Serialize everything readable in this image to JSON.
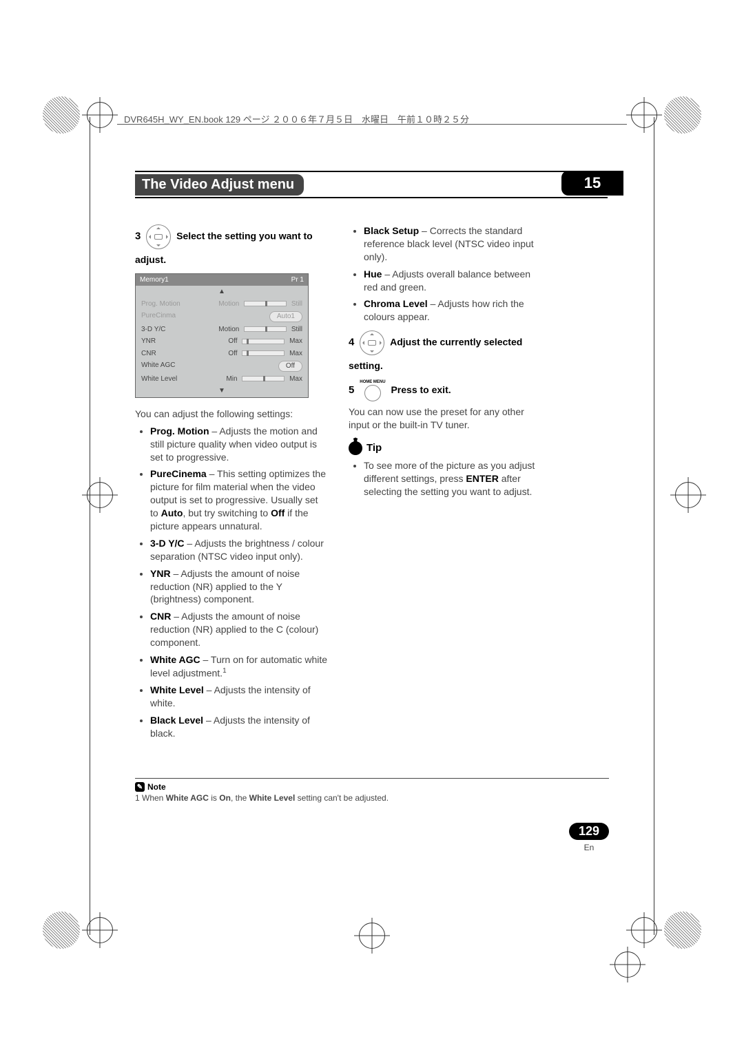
{
  "header_line": "DVR645H_WY_EN.book 129 ページ ２００６年７月５日　水曜日　午前１０時２５分",
  "title": "The Video Adjust menu",
  "chapter": "15",
  "step3": {
    "num": "3",
    "text_a": "Select the setting you want to",
    "text_b": "adjust."
  },
  "intro": "You can adjust the following settings:",
  "bullets_left": [
    {
      "term": "Prog. Motion",
      "text": " – Adjusts the motion and still picture quality when video output is set to progressive."
    },
    {
      "term": "PureCinema",
      "html": " – This setting optimizes the picture for film material when the video output is set to progressive. Usually set to <b>Auto</b>, but try switching to <b>Off</b> if the picture appears unnatural."
    },
    {
      "term": "3-D Y/C",
      "text": " – Adjusts the brightness / colour separation (NTSC video input only)."
    },
    {
      "term": "YNR",
      "text": " – Adjusts the amount of noise reduction (NR) applied to the Y (brightness) component."
    },
    {
      "term": "CNR",
      "text": " – Adjusts the amount of noise reduction (NR) applied to the C (colour) component."
    },
    {
      "term": "White AGC",
      "text": " – Turn on for automatic white level adjustment.",
      "sup": "1"
    },
    {
      "term": "White Level",
      "text": " – Adjusts the intensity of white."
    },
    {
      "term": "Black Level",
      "text": " – Adjusts the intensity of black."
    }
  ],
  "bullets_right_top": [
    {
      "term": "Black Setup",
      "text": " – Corrects the standard reference black level (NTSC video input only)."
    },
    {
      "term": "Hue",
      "text": " – Adjusts overall balance between red and green."
    },
    {
      "term": "Chroma Level",
      "text": " – Adjusts how rich the colours appear."
    }
  ],
  "step4": {
    "num": "4",
    "text_a": "Adjust the currently selected",
    "text_b": "setting."
  },
  "step5": {
    "num": "5",
    "label": "HOME MENU",
    "text": "Press to exit."
  },
  "after5": "You can now use the preset for any other input or the built-in TV tuner.",
  "tip_title": "Tip",
  "tip_item": "To see more of the picture as you adjust different settings, press ",
  "tip_bold": "ENTER",
  "tip_item2": " after selecting the setting you want to adjust.",
  "note_title": "Note",
  "note_text_a": "1 When ",
  "note_b1": "White AGC",
  "note_text_b": " is ",
  "note_b2": "On",
  "note_text_c": ", the ",
  "note_b3": "White Level",
  "note_text_d": " setting can't be adjusted.",
  "page_number": "129",
  "page_lang": "En",
  "menu": {
    "title": "Memory1",
    "badge": "Pr 1",
    "rows": [
      {
        "label": "Prog. Motion",
        "left": "Motion",
        "right": "Still",
        "slider": "center",
        "dim": true
      },
      {
        "label": "PureCinma",
        "pill": "Auto1",
        "dim": true
      },
      {
        "label": "3-D Y/C",
        "left": "Motion",
        "right": "Still",
        "slider": "center"
      },
      {
        "label": "YNR",
        "left": "Off",
        "right": "Max",
        "slider": "left"
      },
      {
        "label": "CNR",
        "left": "Off",
        "right": "Max",
        "slider": "left"
      },
      {
        "label": "White AGC",
        "pill": "Off"
      },
      {
        "label": "White Level",
        "left": "Min",
        "right": "Max",
        "slider": "center"
      }
    ]
  }
}
